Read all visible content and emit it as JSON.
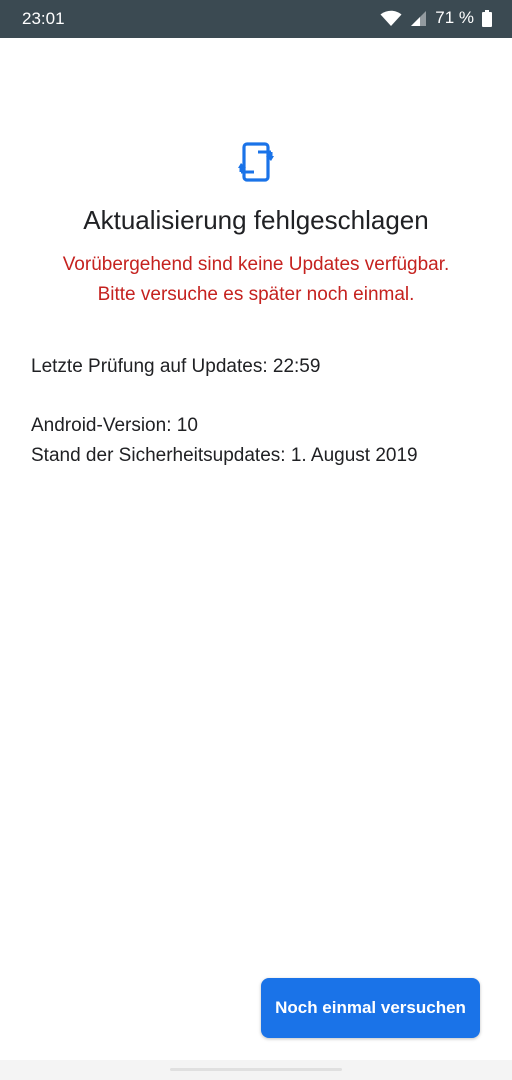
{
  "status_bar": {
    "time": "23:01",
    "battery": "71 %",
    "icons": [
      "wifi-icon",
      "cellular-signal-icon",
      "battery-icon"
    ],
    "background_color": "#3b4a52"
  },
  "main": {
    "icon": "system-update-icon",
    "title": "Aktualisierung fehlgeschlagen",
    "error_line1": "Vorübergehend sind keine Updates verfügbar.",
    "error_line2": "Bitte versuche es später noch einmal.",
    "last_check": "Letzte Prüfung auf Updates: 22:59",
    "android_version": "Android-Version: 10",
    "security_patch": "Stand der Sicherheitsupdates: 1. August 2019"
  },
  "button": {
    "retry_label": "Noch einmal versuchen"
  },
  "colors": {
    "accent": "#1a73e8",
    "error": "#c5221f",
    "text": "#202124"
  }
}
